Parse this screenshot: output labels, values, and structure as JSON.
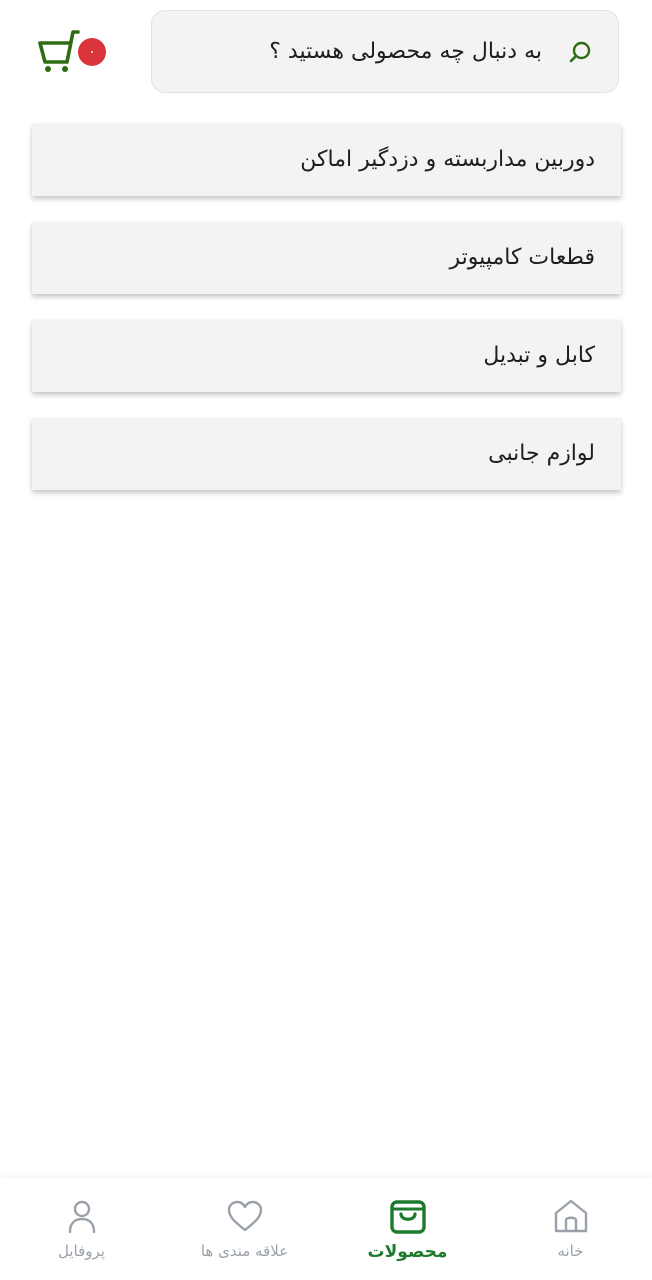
{
  "search": {
    "placeholder": "به دنبال چه محصولی هستید ؟",
    "icon": "search-icon"
  },
  "cart": {
    "icon": "cart-icon",
    "count": "۰"
  },
  "categories": [
    {
      "label": "دوربین مداربسته و دزدگیر اماکن"
    },
    {
      "label": "قطعات کامپیوتر"
    },
    {
      "label": "کابل و تبدیل"
    },
    {
      "label": "لوازم جانبی"
    }
  ],
  "bottom_nav": {
    "items": [
      {
        "label": "خانه",
        "icon": "home-icon",
        "active": false
      },
      {
        "label": "محصولات",
        "icon": "shopping-bag-icon",
        "active": true
      },
      {
        "label": "علاقه مندی ها",
        "icon": "heart-icon",
        "active": false
      },
      {
        "label": "پروفایل",
        "icon": "user-icon",
        "active": false
      }
    ]
  },
  "colors": {
    "accent": "#1f7a2e",
    "icon_green": "#2e6b12",
    "badge": "#d9353a",
    "inactive": "#9aa1ab"
  }
}
